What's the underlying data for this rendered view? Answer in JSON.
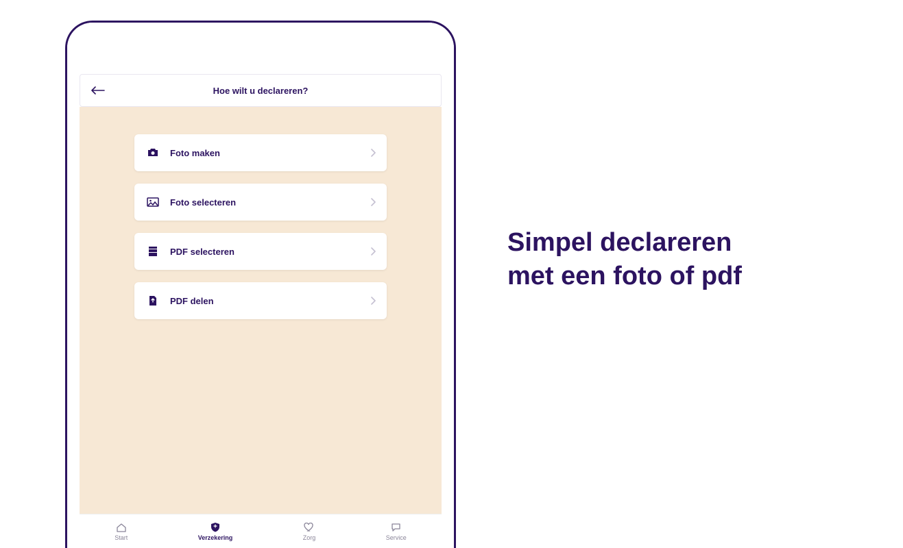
{
  "appbar": {
    "title": "Hoe wilt u declareren?"
  },
  "options": [
    {
      "label": "Foto maken",
      "icon": "camera"
    },
    {
      "label": "Foto selecteren",
      "icon": "image"
    },
    {
      "label": "PDF selecteren",
      "icon": "pdf"
    },
    {
      "label": "PDF delen",
      "icon": "file-share"
    }
  ],
  "nav": [
    {
      "label": "Start",
      "icon": "home",
      "active": false
    },
    {
      "label": "Verzekering",
      "icon": "shield",
      "active": true
    },
    {
      "label": "Zorg",
      "icon": "heart",
      "active": false
    },
    {
      "label": "Service",
      "icon": "chat",
      "active": false
    }
  ],
  "promo": {
    "line1": "Simpel declareren",
    "line2": "met een foto of pdf"
  }
}
